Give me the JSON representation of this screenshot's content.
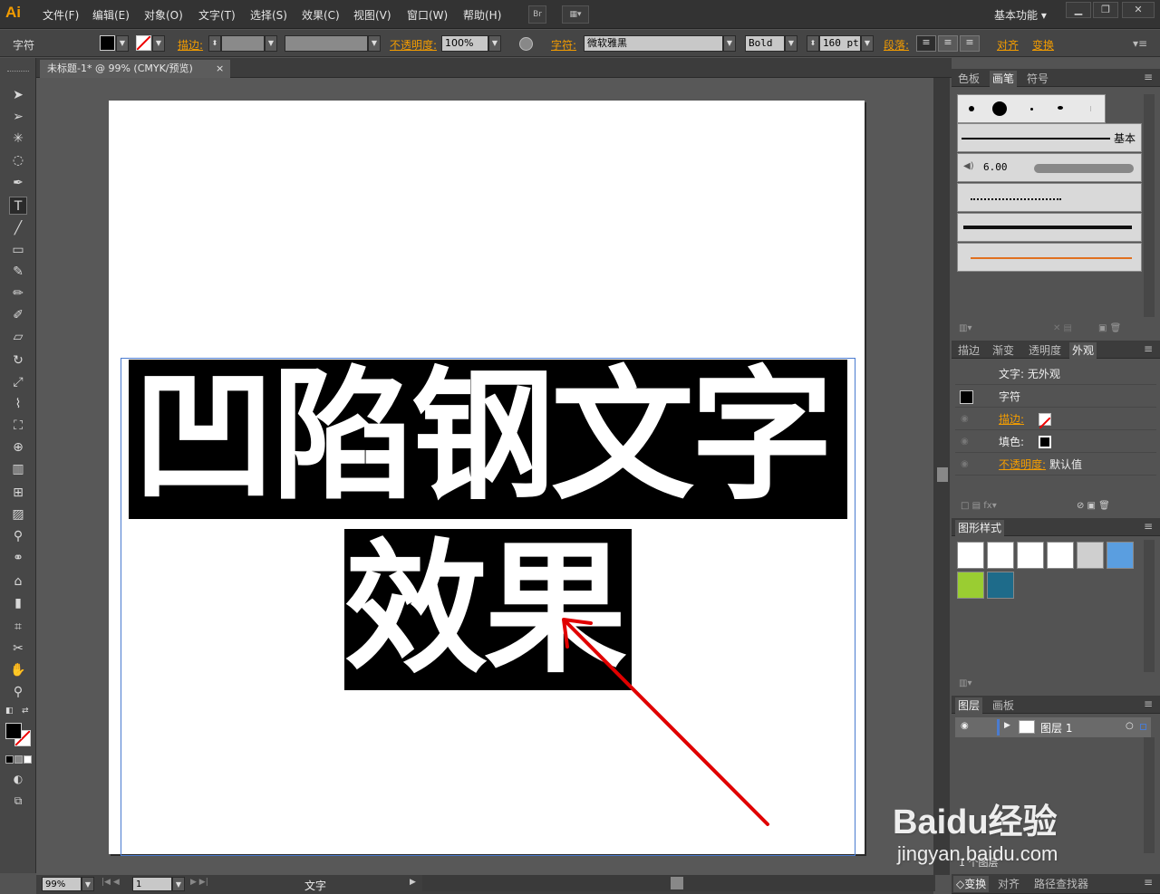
{
  "app": {
    "logo": "Ai"
  },
  "menu": [
    "文件(F)",
    "编辑(E)",
    "对象(O)",
    "文字(T)",
    "选择(S)",
    "效果(C)",
    "视图(V)",
    "窗口(W)",
    "帮助(H)"
  ],
  "bridge_label": "Br",
  "workspace": "基本功能",
  "control": {
    "section": "字符",
    "stroke_label": "描边:",
    "opacity_label": "不透明度:",
    "opacity_value": "100%",
    "char_label": "字符:",
    "font_name": "微软雅黑",
    "font_style": "Bold",
    "font_size": "160 pt",
    "para_label": "段落:",
    "align_label": "对齐",
    "transform_label": "变换"
  },
  "document_tab": {
    "title": "未标题-1* @ 99% (CMYK/预览)",
    "close": "×"
  },
  "artboard": {
    "line1": "凹陷钢文字",
    "line2": "效果"
  },
  "status": {
    "zoom": "99%",
    "page": "1",
    "tool": "文字"
  },
  "panels": {
    "brushes_tabs": [
      "色板",
      "画笔",
      "符号"
    ],
    "brush_basic_label": "基本",
    "brush_size": "6.00",
    "appearance_tabs": [
      "描边",
      "渐变",
      "透明度",
      "外观"
    ],
    "appearance": {
      "header": "文字: 无外观",
      "char_label": "字符",
      "stroke_label": "描边:",
      "fill_label": "填色:",
      "opacity_label": "不透明度:",
      "opacity_value": "默认值"
    },
    "graphic_styles_tab": "图形样式",
    "layers_tabs": [
      "图层",
      "画板"
    ],
    "layer_name": "图层 1",
    "layer_count": "1 个图层",
    "bottom_tabs": [
      "变换",
      "对齐",
      "路径查找器"
    ]
  },
  "watermark": {
    "brand": "Baidu经验",
    "url": "jingyan.baidu.com"
  },
  "colors": {
    "accent": "#f39c00",
    "arrow": "#e00000",
    "selection": "#4a7bd0"
  }
}
